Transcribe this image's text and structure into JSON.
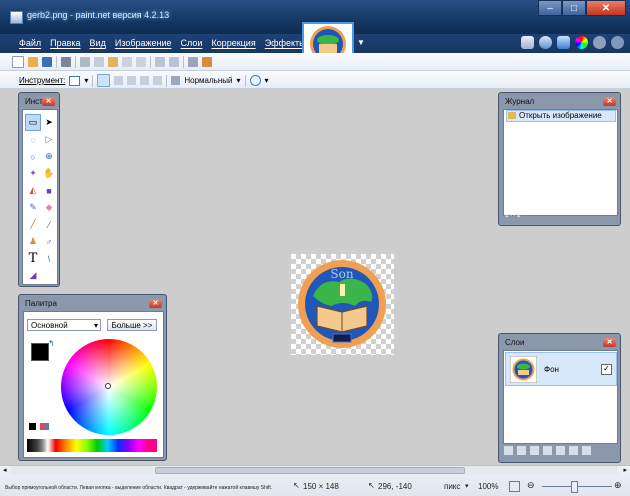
{
  "app": {
    "title": "gerb2.png - paint.net версия 4.2.13"
  },
  "window_controls": {
    "minimize": "–",
    "maximize": "□",
    "close": "✕"
  },
  "menu": [
    "Файл",
    "Правка",
    "Вид",
    "Изображение",
    "Слои",
    "Коррекция",
    "Эффекты"
  ],
  "right_toolbar_icons": [
    "tools-window-icon",
    "history-window-icon",
    "layers-window-icon",
    "colors-window-icon",
    "settings-icon",
    "help-icon"
  ],
  "toolbar2": {
    "tool_label": "Инструмент:",
    "blend_mode": "Нормальный"
  },
  "tools_window": {
    "title": "Инст...",
    "tools": [
      "rectangle-select",
      "move-selection",
      "lasso-select",
      "move-selection-outline",
      "ellipse-select",
      "zoom",
      "magic-wand",
      "pan",
      "paint-bucket",
      "gradient",
      "paintbrush",
      "eraser",
      "pencil",
      "color-picker",
      "clone-stamp",
      "recolor",
      "text",
      "line-curve",
      "shapes"
    ]
  },
  "history_window": {
    "title": "Журнал",
    "items": [
      "Открыть изображение"
    ]
  },
  "palette_window": {
    "title": "Палитра",
    "mode": "Основной",
    "more_button": "Больше >>"
  },
  "layers_window": {
    "title": "Слои",
    "layers": [
      {
        "name": "Фон",
        "visible": true
      }
    ]
  },
  "status": {
    "hint": "Выбор прямоугольной области. Левая кнопка - выделение области. Квадрат - удерживайте нажатой клавишу Shift.",
    "image_size": "150 × 148",
    "cursor_pos": "296, -140",
    "units": "пикс",
    "zoom": "100%"
  },
  "colors": {
    "title_bar": "#143764",
    "workspace": "#cdcdcd",
    "panel": "#8b98ab",
    "selection": "#d8e8fb"
  }
}
